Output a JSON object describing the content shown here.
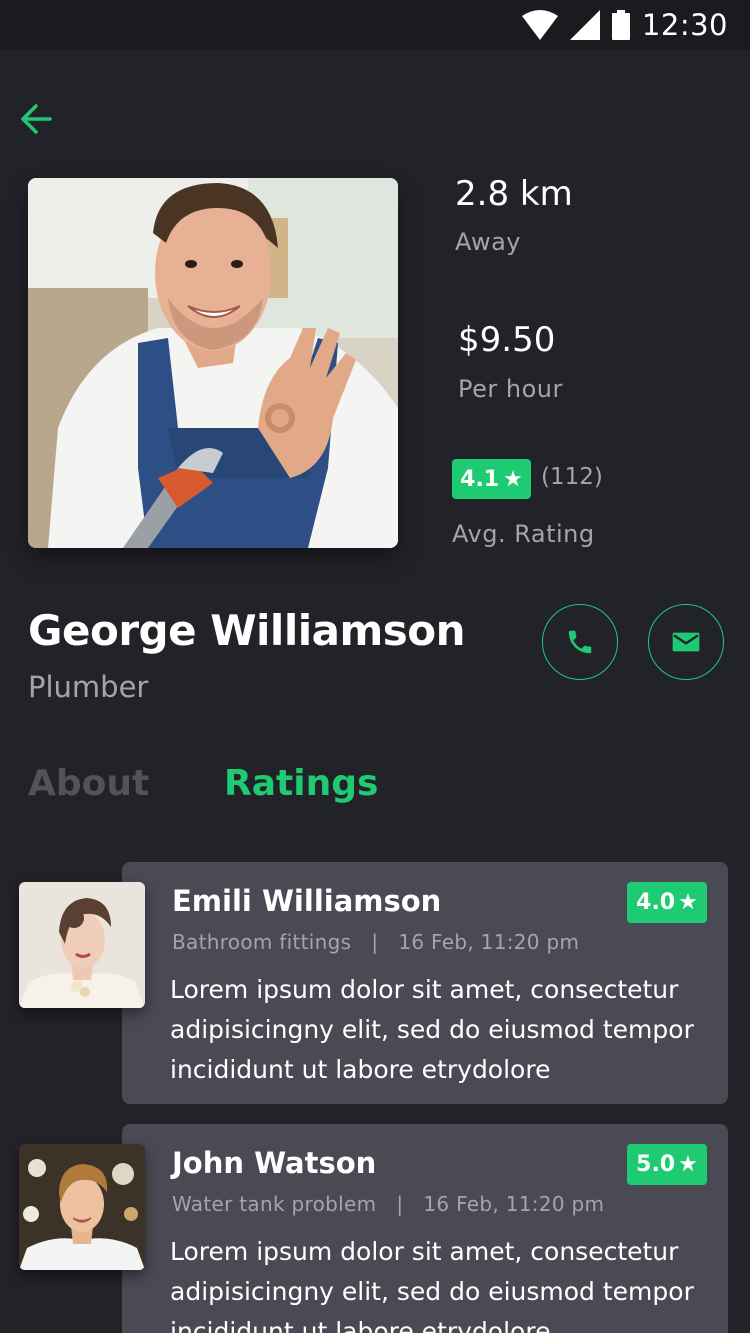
{
  "status_bar": {
    "time": "12:30"
  },
  "profile": {
    "distance": {
      "value": "2.8 km",
      "label": "Away"
    },
    "price": {
      "value": "$9.50",
      "label": "Per hour"
    },
    "rating": {
      "value": "4.1",
      "count": "(112)",
      "label": "Avg. Rating"
    },
    "name": "George Williamson",
    "profession": "Plumber"
  },
  "tabs": [
    {
      "label": "About",
      "active": false
    },
    {
      "label": "Ratings",
      "active": true
    }
  ],
  "reviews": [
    {
      "name": "Emili Williamson",
      "service": "Bathroom fittings",
      "date": "16 Feb, 11:20 pm",
      "rating": "4.0",
      "text": "Lorem ipsum dolor sit amet, consectetur adipisicingny elit, sed do eiusmod tempor incididunt ut labore etrydolore"
    },
    {
      "name": "John Watson",
      "service": "Water tank problem",
      "date": "16 Feb, 11:20 pm",
      "rating": "5.0",
      "text": "Lorem ipsum dolor sit amet, consectetur adipisicingny elit, sed do eiusmod tempor incididunt ut labore etrydolore"
    }
  ],
  "icons": {
    "back": "arrow-left-icon",
    "call": "phone-icon",
    "message": "mail-icon",
    "star": "star-icon"
  },
  "colors": {
    "accent": "#1ecb73",
    "background": "#222229",
    "card": "#4a4a55",
    "muted_text": "#a4a4ad"
  }
}
